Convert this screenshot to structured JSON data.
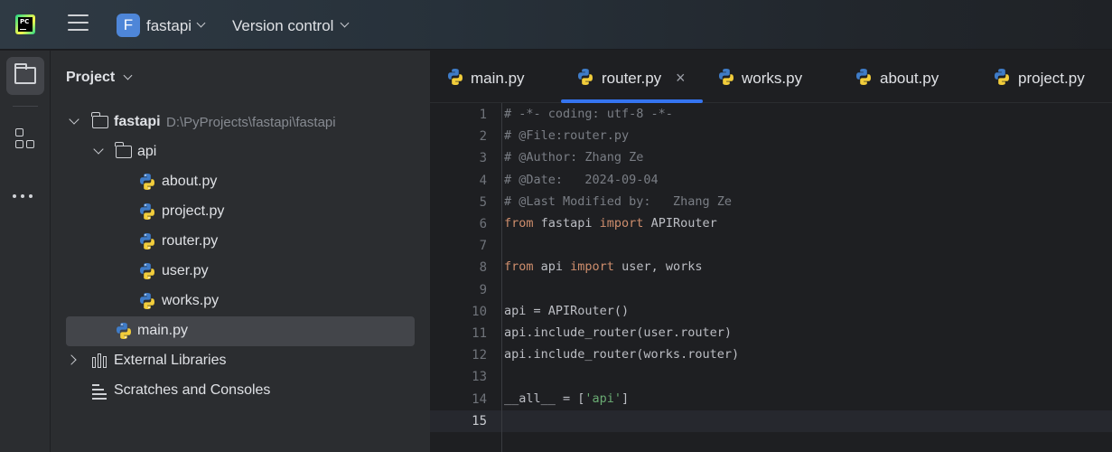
{
  "titlebar": {
    "project_initial": "F",
    "project_name": "fastapi",
    "version_control_label": "Version control"
  },
  "project_panel": {
    "title": "Project",
    "root": {
      "name": "fastapi",
      "path": "D:\\PyProjects\\fastapi\\fastapi"
    },
    "api_folder": "api",
    "api_files": [
      "about.py",
      "project.py",
      "router.py",
      "user.py",
      "works.py"
    ],
    "main_file": "main.py",
    "external_libraries": "External Libraries",
    "scratches": "Scratches and Consoles"
  },
  "tabs": [
    {
      "label": "main.py",
      "active": false
    },
    {
      "label": "router.py",
      "active": true
    },
    {
      "label": "works.py",
      "active": false
    },
    {
      "label": "about.py",
      "active": false
    },
    {
      "label": "project.py",
      "active": false
    }
  ],
  "tab_close_glyph": "×",
  "editor": {
    "line_numbers": [
      "1",
      "2",
      "3",
      "4",
      "5",
      "6",
      "7",
      "8",
      "9",
      "10",
      "11",
      "12",
      "13",
      "14",
      "15"
    ],
    "current_line": "15",
    "lines": {
      "l1": "# -*- coding: utf-8 -*-",
      "l2": "# @File:router.py",
      "l3": "# @Author: Zhang Ze",
      "l4": "# @Date:   2024-09-04",
      "l5": "# @Last Modified by:   Zhang Ze",
      "l6": {
        "k1": "from",
        "t1": " fastapi ",
        "k2": "import",
        "t2": " APIRouter"
      },
      "l8": {
        "k1": "from",
        "t1": " api ",
        "k2": "import",
        "t2": " user, works"
      },
      "l10": "api = APIRouter()",
      "l11": "api.include_router(user.router)",
      "l12": "api.include_router(works.router)",
      "l14": {
        "t1": "__all__ = [",
        "s1": "'api'",
        "t2": "]"
      }
    }
  },
  "colors": {
    "accent": "#3574f0",
    "project_badge": "#4e86d8",
    "keyword": "#cf8e6d",
    "comment": "#7a7e85",
    "string": "#6aab73"
  },
  "icons": {
    "app": "pycharm-logo-icon",
    "menu": "hamburger-menu-icon",
    "project_tool": "folder-icon",
    "structure_tool": "structure-icon",
    "more_tool": "more-dots-icon",
    "python_file": "python-file-icon",
    "libraries": "library-icon",
    "scratches": "scratches-icon"
  }
}
